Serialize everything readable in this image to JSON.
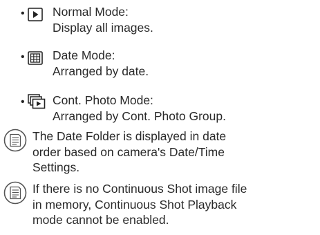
{
  "modes": [
    {
      "icon": "play-icon",
      "title": "Normal Mode:",
      "description": "Display all images."
    },
    {
      "icon": "calendar-grid-icon",
      "title": "Date Mode:",
      "description": "Arranged by date."
    },
    {
      "icon": "continuous-photo-icon",
      "title": "Cont. Photo Mode:",
      "description": "Arranged by Cont. Photo Group."
    }
  ],
  "bullet": "•",
  "notes": [
    {
      "icon": "memo-note-icon",
      "lines": [
        "The Date Folder is displayed in date",
        "order based on camera's Date/Time",
        "Settings."
      ]
    },
    {
      "icon": "memo-note-icon",
      "lines": [
        "If there is no Continuous Shot image file",
        "in memory, Continuous Shot Playback",
        "mode cannot be enabled."
      ]
    }
  ]
}
